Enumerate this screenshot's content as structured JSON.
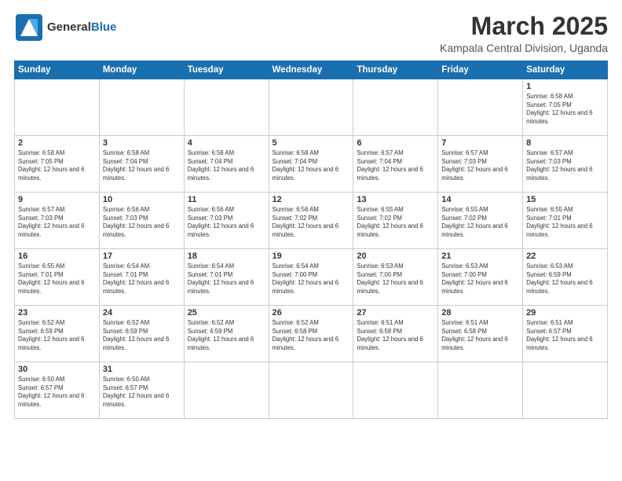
{
  "header": {
    "logo_general": "General",
    "logo_blue": "Blue",
    "main_title": "March 2025",
    "subtitle": "Kampala Central Division, Uganda"
  },
  "calendar": {
    "days_of_week": [
      "Sunday",
      "Monday",
      "Tuesday",
      "Wednesday",
      "Thursday",
      "Friday",
      "Saturday"
    ],
    "weeks": [
      [
        {
          "day": "",
          "empty": true
        },
        {
          "day": "",
          "empty": true
        },
        {
          "day": "",
          "empty": true
        },
        {
          "day": "",
          "empty": true
        },
        {
          "day": "",
          "empty": true
        },
        {
          "day": "",
          "empty": true
        },
        {
          "day": "1",
          "sunrise": "6:58 AM",
          "sunset": "7:05 PM",
          "daylight": "12 hours and 6 minutes."
        }
      ],
      [
        {
          "day": "2",
          "sunrise": "6:58 AM",
          "sunset": "7:05 PM",
          "daylight": "12 hours and 6 minutes."
        },
        {
          "day": "3",
          "sunrise": "6:58 AM",
          "sunset": "7:04 PM",
          "daylight": "12 hours and 6 minutes."
        },
        {
          "day": "4",
          "sunrise": "6:58 AM",
          "sunset": "7:04 PM",
          "daylight": "12 hours and 6 minutes."
        },
        {
          "day": "5",
          "sunrise": "6:58 AM",
          "sunset": "7:04 PM",
          "daylight": "12 hours and 6 minutes."
        },
        {
          "day": "6",
          "sunrise": "6:57 AM",
          "sunset": "7:04 PM",
          "daylight": "12 hours and 6 minutes."
        },
        {
          "day": "7",
          "sunrise": "6:57 AM",
          "sunset": "7:03 PM",
          "daylight": "12 hours and 6 minutes."
        },
        {
          "day": "8",
          "sunrise": "6:57 AM",
          "sunset": "7:03 PM",
          "daylight": "12 hours and 6 minutes."
        }
      ],
      [
        {
          "day": "9",
          "sunrise": "6:57 AM",
          "sunset": "7:03 PM",
          "daylight": "12 hours and 6 minutes."
        },
        {
          "day": "10",
          "sunrise": "6:56 AM",
          "sunset": "7:03 PM",
          "daylight": "12 hours and 6 minutes."
        },
        {
          "day": "11",
          "sunrise": "6:56 AM",
          "sunset": "7:03 PM",
          "daylight": "12 hours and 6 minutes."
        },
        {
          "day": "12",
          "sunrise": "6:56 AM",
          "sunset": "7:02 PM",
          "daylight": "12 hours and 6 minutes."
        },
        {
          "day": "13",
          "sunrise": "6:55 AM",
          "sunset": "7:02 PM",
          "daylight": "12 hours and 6 minutes."
        },
        {
          "day": "14",
          "sunrise": "6:55 AM",
          "sunset": "7:02 PM",
          "daylight": "12 hours and 6 minutes."
        },
        {
          "day": "15",
          "sunrise": "6:55 AM",
          "sunset": "7:01 PM",
          "daylight": "12 hours and 6 minutes."
        }
      ],
      [
        {
          "day": "16",
          "sunrise": "6:55 AM",
          "sunset": "7:01 PM",
          "daylight": "12 hours and 6 minutes."
        },
        {
          "day": "17",
          "sunrise": "6:54 AM",
          "sunset": "7:01 PM",
          "daylight": "12 hours and 6 minutes."
        },
        {
          "day": "18",
          "sunrise": "6:54 AM",
          "sunset": "7:01 PM",
          "daylight": "12 hours and 6 minutes."
        },
        {
          "day": "19",
          "sunrise": "6:54 AM",
          "sunset": "7:00 PM",
          "daylight": "12 hours and 6 minutes."
        },
        {
          "day": "20",
          "sunrise": "6:53 AM",
          "sunset": "7:00 PM",
          "daylight": "12 hours and 6 minutes."
        },
        {
          "day": "21",
          "sunrise": "6:53 AM",
          "sunset": "7:00 PM",
          "daylight": "12 hours and 6 minutes."
        },
        {
          "day": "22",
          "sunrise": "6:53 AM",
          "sunset": "6:59 PM",
          "daylight": "12 hours and 6 minutes."
        }
      ],
      [
        {
          "day": "23",
          "sunrise": "6:52 AM",
          "sunset": "6:59 PM",
          "daylight": "12 hours and 6 minutes."
        },
        {
          "day": "24",
          "sunrise": "6:52 AM",
          "sunset": "6:59 PM",
          "daylight": "12 hours and 6 minutes."
        },
        {
          "day": "25",
          "sunrise": "6:52 AM",
          "sunset": "6:59 PM",
          "daylight": "12 hours and 6 minutes."
        },
        {
          "day": "26",
          "sunrise": "6:52 AM",
          "sunset": "6:58 PM",
          "daylight": "12 hours and 6 minutes."
        },
        {
          "day": "27",
          "sunrise": "6:51 AM",
          "sunset": "6:58 PM",
          "daylight": "12 hours and 6 minutes."
        },
        {
          "day": "28",
          "sunrise": "6:51 AM",
          "sunset": "6:58 PM",
          "daylight": "12 hours and 6 minutes."
        },
        {
          "day": "29",
          "sunrise": "6:51 AM",
          "sunset": "6:57 PM",
          "daylight": "12 hours and 6 minutes."
        }
      ],
      [
        {
          "day": "30",
          "sunrise": "6:50 AM",
          "sunset": "6:57 PM",
          "daylight": "12 hours and 6 minutes."
        },
        {
          "day": "31",
          "sunrise": "6:50 AM",
          "sunset": "6:57 PM",
          "daylight": "12 hours and 6 minutes."
        },
        {
          "day": "",
          "empty": true
        },
        {
          "day": "",
          "empty": true
        },
        {
          "day": "",
          "empty": true
        },
        {
          "day": "",
          "empty": true
        },
        {
          "day": "",
          "empty": true
        }
      ]
    ]
  }
}
